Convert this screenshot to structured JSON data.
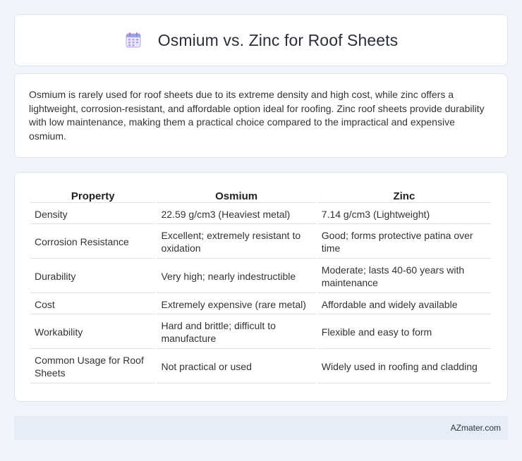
{
  "header": {
    "title": "Osmium vs. Zinc for Roof Sheets",
    "icon": "calendar-icon"
  },
  "summary": {
    "text": "Osmium is rarely used for roof sheets due to its extreme density and high cost, while zinc offers a lightweight, corrosion-resistant, and affordable option ideal for roofing. Zinc roof sheets provide durability with low maintenance, making them a practical choice compared to the impractical and expensive osmium."
  },
  "table": {
    "headers": [
      "Property",
      "Osmium",
      "Zinc"
    ],
    "rows": [
      [
        "Density",
        "22.59 g/cm3 (Heaviest metal)",
        "7.14 g/cm3 (Lightweight)"
      ],
      [
        "Corrosion Resistance",
        "Excellent; extremely resistant to oxidation",
        "Good; forms protective patina over time"
      ],
      [
        "Durability",
        "Very high; nearly indestructible",
        "Moderate; lasts 40-60 years with maintenance"
      ],
      [
        "Cost",
        "Extremely expensive (rare metal)",
        "Affordable and widely available"
      ],
      [
        "Workability",
        "Hard and brittle; difficult to manufacture",
        "Flexible and easy to form"
      ],
      [
        "Common Usage for Roof Sheets",
        "Not practical or used",
        "Widely used in roofing and cladding"
      ]
    ]
  },
  "footer": {
    "text": "AZmater.com"
  }
}
